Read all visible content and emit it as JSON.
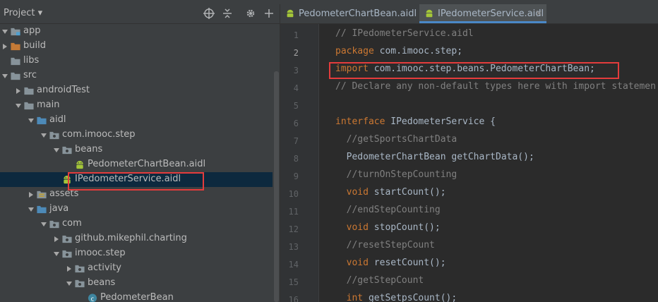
{
  "project_panel": {
    "title": "Project ▾",
    "tree": [
      {
        "label": "app",
        "icon": "module-folder-icon"
      },
      {
        "label": "build",
        "icon": "orange-folder-icon"
      },
      {
        "label": "libs",
        "icon": "folder-icon"
      },
      {
        "label": "src",
        "icon": "folder-icon"
      },
      {
        "label": "androidTest",
        "icon": "folder-icon"
      },
      {
        "label": "main",
        "icon": "folder-icon"
      },
      {
        "label": "aidl",
        "icon": "blue-folder-icon"
      },
      {
        "label": "com.imooc.step",
        "icon": "package-icon"
      },
      {
        "label": "beans",
        "icon": "package-icon"
      },
      {
        "label": "PedometerChartBean.aidl",
        "icon": "android-icon"
      },
      {
        "label": "IPedometerService.aidl",
        "icon": "android-icon"
      },
      {
        "label": "assets",
        "icon": "resource-folder-icon"
      },
      {
        "label": "java",
        "icon": "blue-folder-icon"
      },
      {
        "label": "com",
        "icon": "package-icon"
      },
      {
        "label": "github.mikephil.charting",
        "icon": "package-icon"
      },
      {
        "label": "imooc.step",
        "icon": "package-icon"
      },
      {
        "label": "activity",
        "icon": "package-icon"
      },
      {
        "label": "beans",
        "icon": "package-icon"
      },
      {
        "label": "PedometerBean",
        "icon": "class-icon"
      }
    ]
  },
  "editor": {
    "tabs": [
      {
        "label": "PedometerChartBean.aidl",
        "active": false
      },
      {
        "label": "IPedometerService.aidl",
        "active": true
      }
    ],
    "current_line": 2,
    "lines": [
      {
        "n": "1",
        "t1": "// IPedometerService.aidl",
        "t2": ""
      },
      {
        "n": "2",
        "t1": "package",
        "t2": " com.imooc.step;"
      },
      {
        "n": "3",
        "t1": "import",
        "t2": " com.imooc.step.beans.PedometerChartBean;"
      },
      {
        "n": "4",
        "t1": "// Declare any non-default types here with import statemen",
        "t2": ""
      },
      {
        "n": "5",
        "t1": "",
        "t2": ""
      },
      {
        "n": "6",
        "t1": "interface",
        "t2": " IPedometerService {"
      },
      {
        "n": "7",
        "t1": "  //getSportsChartData",
        "t2": ""
      },
      {
        "n": "8",
        "t1": "  PedometerChartBean",
        "t2": " getChartData();"
      },
      {
        "n": "9",
        "t1": "  //turnOnStepCounting",
        "t2": ""
      },
      {
        "n": "10",
        "t1": "  void",
        "t2": " startCount();"
      },
      {
        "n": "11",
        "t1": "  //endStepCounting",
        "t2": ""
      },
      {
        "n": "12",
        "t1": "  void",
        "t2": " stopCount();"
      },
      {
        "n": "13",
        "t1": "  //resetStepCount",
        "t2": ""
      },
      {
        "n": "14",
        "t1": "  void",
        "t2": " resetCount();"
      },
      {
        "n": "15",
        "t1": "  //getStepCount",
        "t2": ""
      },
      {
        "n": "16",
        "t1": "  int",
        "t2": " getSetpsCount();"
      }
    ]
  },
  "colors": {
    "accent": "#4a88c7",
    "highlight_box": "#e43c3c",
    "keyword": "#cc7832",
    "comment": "#808080"
  }
}
